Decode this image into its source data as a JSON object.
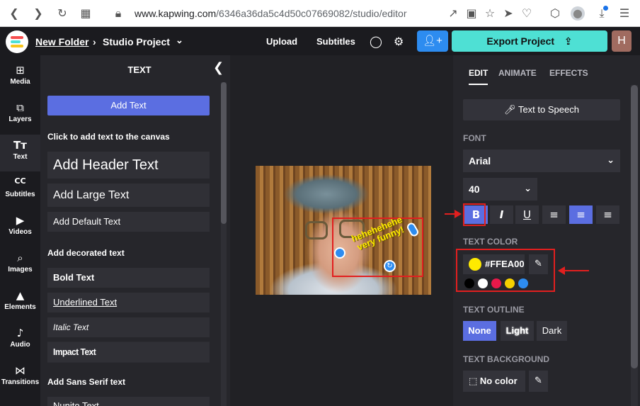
{
  "browser": {
    "url_domain": "www.kapwing.com",
    "url_path": "/6346a36da5c4d50c07669082/studio/editor",
    "icons": [
      "back-icon",
      "forward-icon",
      "reload-icon",
      "apps-icon",
      "lock-icon",
      "share-icon",
      "camera-icon",
      "bookmark-icon",
      "send-icon",
      "heart-icon",
      "cube-icon",
      "profile-icon",
      "download-icon",
      "menu-icon"
    ]
  },
  "topbar": {
    "folder": "New Folder",
    "separator": "›",
    "project": "Studio Project",
    "upload": "Upload",
    "subtitles": "Subtitles",
    "export": "Export Project",
    "avatar_letter": "H"
  },
  "sidebar": {
    "items": [
      {
        "label": "Media",
        "icon": "plus-square-icon"
      },
      {
        "label": "Layers",
        "icon": "layers-icon"
      },
      {
        "label": "Text",
        "icon": "text-icon"
      },
      {
        "label": "Subtitles",
        "icon": "cc-icon"
      },
      {
        "label": "Videos",
        "icon": "video-icon"
      },
      {
        "label": "Images",
        "icon": "search-icon"
      },
      {
        "label": "Elements",
        "icon": "shapes-icon"
      },
      {
        "label": "Audio",
        "icon": "music-icon"
      },
      {
        "label": "Transitions",
        "icon": "transition-icon"
      }
    ]
  },
  "text_panel": {
    "title": "TEXT",
    "add_text": "Add Text",
    "click_hint": "Click to add text to the canvas",
    "header_text": "Add Header Text",
    "large_text": "Add Large Text",
    "default_text": "Add Default Text",
    "decorated_heading": "Add decorated text",
    "bold_text": "Bold Text",
    "underlined_text": "Underlined Text",
    "italic_text": "Italic Text",
    "impact_text": "Impact Text",
    "sans_serif_heading": "Add Sans Serif text",
    "partial_text": "Nunito Text"
  },
  "canvas": {
    "overlay_line1": "hehehehehe",
    "overlay_line2": "very funny!"
  },
  "right_panel": {
    "tabs": [
      "EDIT",
      "ANIMATE",
      "EFFECTS"
    ],
    "tts": "Text to Speech",
    "font_label": "FONT",
    "font_value": "Arial",
    "size_value": "40",
    "text_color_label": "TEXT COLOR",
    "color_hex": "#FFEA00",
    "swatches": [
      "#000000",
      "#ffffff",
      "#e8194a",
      "#f5d000",
      "#2d8cf0"
    ],
    "outline_label": "TEXT OUTLINE",
    "outline_options": [
      "None",
      "Light",
      "Dark"
    ],
    "background_label": "TEXT BACKGROUND",
    "no_color": "No color"
  },
  "colors": {
    "accent": "#5b6ee1",
    "export": "#4ee0d4",
    "highlight": "#e21f1f"
  }
}
